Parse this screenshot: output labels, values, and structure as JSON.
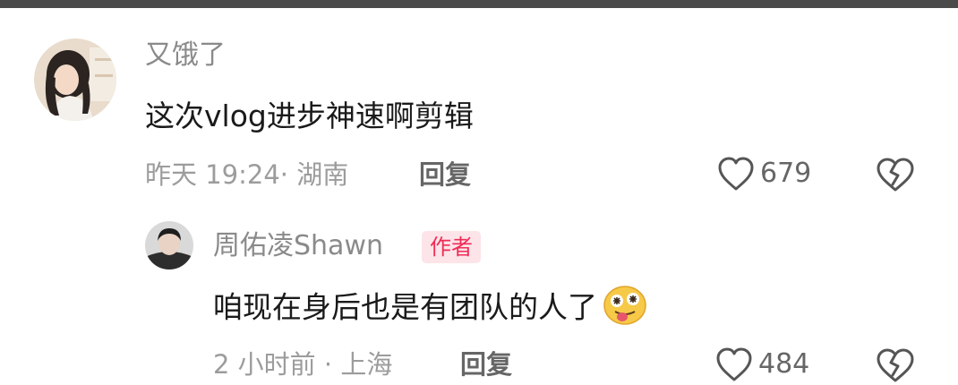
{
  "comments": [
    {
      "username": "又饿了",
      "text": "这次vlog进步神速啊剪辑",
      "meta": "昨天 19:24· 湖南",
      "reply_label": "回复",
      "likes": "679"
    },
    {
      "username": "周佑凌Shawn",
      "badge": "作者",
      "text": "咱现在身后也是有团队的人了",
      "meta": "2 小时前 · 上海",
      "reply_label": "回复",
      "likes": "484"
    }
  ],
  "icons": {
    "like": "heart-outline-icon",
    "dislike": "broken-heart-icon",
    "emoji": "dizzy-face-tongue-emoji"
  },
  "colors": {
    "badge_bg": "#fde4e8",
    "badge_text": "#f02c57",
    "name": "#8a8a8a",
    "meta": "#9c9c9c"
  }
}
